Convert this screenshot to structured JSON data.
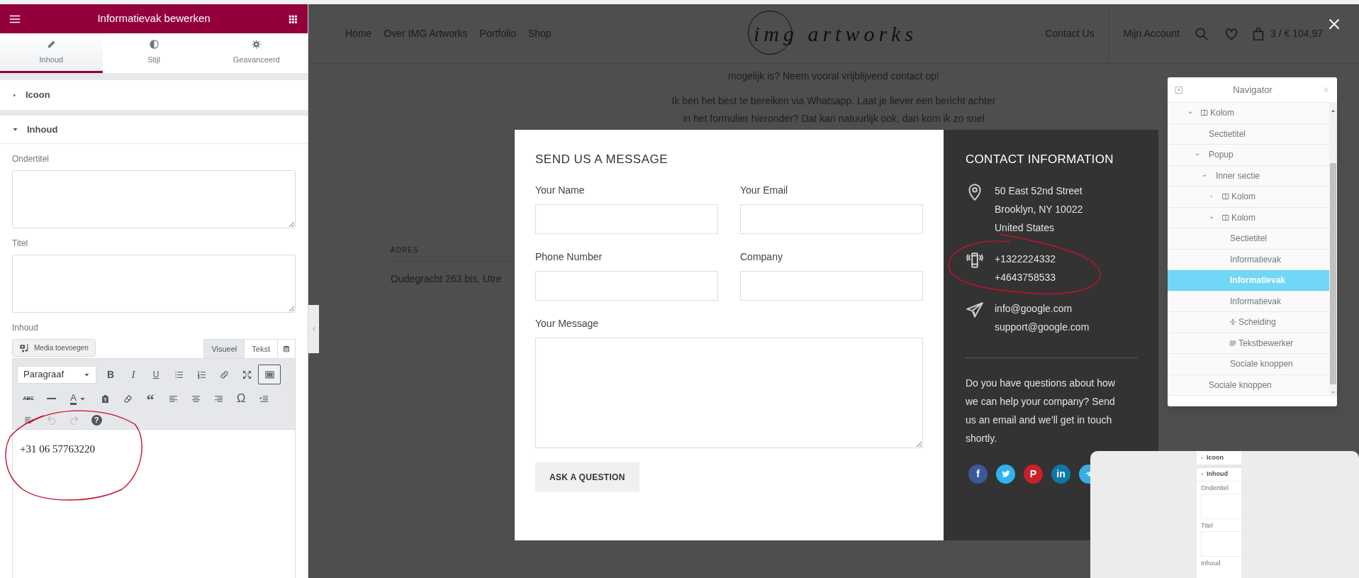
{
  "editor_panel": {
    "title": "Informatievak bewerken",
    "tabs": [
      {
        "label": "Inhoud",
        "kind": "pencil",
        "selected": true
      },
      {
        "label": "Stijl",
        "kind": "contrast",
        "selected": false
      },
      {
        "label": "Geavanceerd",
        "kind": "gear",
        "selected": false
      }
    ],
    "sections": [
      {
        "title": "Icoon",
        "expanded": false
      },
      {
        "title": "Inhoud",
        "expanded": true
      }
    ],
    "fields": [
      {
        "label": "Ondertitel"
      },
      {
        "label": "Titel"
      }
    ],
    "editor": {
      "label": "Inhoud",
      "media_button": "Media toevoegen",
      "modes": [
        {
          "label": "Visueel",
          "selected": true
        },
        {
          "label": "Tekst",
          "selected": false
        }
      ],
      "format": "Paragraaf",
      "toolbar": [
        [
          {
            "kind": "bold",
            "glyph": "B",
            "selected": false
          },
          {
            "kind": "italic",
            "glyph": "I",
            "selected": false
          },
          {
            "kind": "underline",
            "glyph": "U",
            "selected": false
          },
          {
            "kind": "bullet-list",
            "selected": false
          },
          {
            "kind": "numbered-list",
            "selected": false
          },
          {
            "kind": "link",
            "selected": false
          },
          {
            "kind": "fullscreen",
            "selected": false
          },
          {
            "kind": "toolbar-toggle",
            "selected": true
          }
        ],
        [
          {
            "kind": "strikethrough",
            "glyph": "ABC"
          },
          {
            "kind": "horizontal-line"
          },
          {
            "kind": "text-color",
            "glyph": "A"
          },
          {
            "kind": "paste-text"
          },
          {
            "kind": "clear-formatting"
          },
          {
            "kind": "blockquote",
            "glyph": "“"
          },
          {
            "kind": "align-left"
          },
          {
            "kind": "align-center"
          },
          {
            "kind": "align-right"
          },
          {
            "kind": "special-character",
            "glyph": "Ω"
          },
          {
            "kind": "indent"
          }
        ],
        [
          {
            "kind": "outdent",
            "disabled": false
          },
          {
            "kind": "undo",
            "disabled": true
          },
          {
            "kind": "redo",
            "disabled": true
          },
          {
            "kind": "help",
            "glyph": "?",
            "disabled": false
          }
        ]
      ],
      "content": "+31 06 57763220"
    }
  },
  "site_header": {
    "nav": [
      "Home",
      "Over IMG Artworks",
      "Portfolio",
      "Shop"
    ],
    "logo": "img artworks",
    "right_links": [
      "Contact Us",
      "Mijn Account"
    ],
    "cart": "3 / € 104,97"
  },
  "page": {
    "paragraphs": [
      [
        "mogelijk is? Neem vooral vrijblijvend contact op!"
      ],
      [
        "Ik ben het best te bereiken via Whatsapp. Laat je liever een bericht achter",
        "in het formulier hieronder? Dat kan natuurlijk ook, dan kom ik zo snel"
      ]
    ],
    "address_heading": "ADRES",
    "address": "Oudegracht 263 bis, Utre"
  },
  "popup": {
    "form": {
      "title": "SEND US A MESSAGE",
      "fields": [
        {
          "label": "Your Name",
          "kind": "input"
        },
        {
          "label": "Your Email",
          "kind": "input"
        },
        {
          "label": "Phone Number",
          "kind": "input"
        },
        {
          "label": "Company",
          "kind": "input"
        },
        {
          "label": "Your Message",
          "kind": "textarea"
        }
      ],
      "submit": "ASK A QUESTION"
    },
    "contact": {
      "title": "CONTACT INFORMATION",
      "items": [
        {
          "kind": "location",
          "lines": [
            "50 East 52nd Street",
            "Brooklyn, NY 10022",
            "United States"
          ]
        },
        {
          "kind": "phone",
          "lines": [
            "+1322224332",
            "+4643758533"
          ]
        },
        {
          "kind": "send",
          "lines": [
            "info@google.com",
            "support@google.com"
          ]
        }
      ],
      "text": "Do you have questions about how we can help your company? Send us an email and we’ll get in touch shortly.",
      "social": [
        {
          "kind": "facebook",
          "glyph": "f",
          "color": "#3b5998"
        },
        {
          "kind": "twitter",
          "color": "#2ab5f0"
        },
        {
          "kind": "pinterest",
          "glyph": "P",
          "color": "#cb2027"
        },
        {
          "kind": "linkedin",
          "glyph": "in",
          "color": "#0e76a8"
        },
        {
          "kind": "telegram",
          "color": "#37aee2"
        }
      ]
    }
  },
  "navigator": {
    "title": "Navigator",
    "tree": [
      {
        "label": "Kolom",
        "kind": "column",
        "expanded": true,
        "selected": false,
        "children": [
          {
            "label": "Sectietitel",
            "selected": false
          },
          {
            "label": "Popup",
            "expanded": true,
            "selected": false,
            "children": [
              {
                "label": "Inner sectie",
                "expanded": true,
                "selected": false,
                "children": [
                  {
                    "label": "Kolom",
                    "kind": "column",
                    "expanded": false,
                    "selected": false
                  },
                  {
                    "label": "Kolom",
                    "kind": "column",
                    "expanded": true,
                    "selected": false,
                    "children": [
                      {
                        "label": "Sectietitel",
                        "selected": false
                      },
                      {
                        "label": "Informatievak",
                        "selected": false
                      },
                      {
                        "label": "Informatievak",
                        "selected": true
                      },
                      {
                        "label": "Informatievak",
                        "selected": false
                      },
                      {
                        "label": "Scheiding",
                        "kind": "divider",
                        "selected": false
                      },
                      {
                        "label": "Tekstbewerker",
                        "kind": "text",
                        "selected": false
                      },
                      {
                        "label": "Sociale knoppen",
                        "selected": false
                      }
                    ]
                  }
                ]
              }
            ]
          },
          {
            "label": "Sociale knoppen",
            "selected": false
          }
        ]
      }
    ]
  },
  "drag_preview": {
    "sections": [
      {
        "title": "Icoon",
        "expanded": false
      },
      {
        "title": "Inhoud",
        "expanded": true
      }
    ],
    "labels": [
      "Ondertitel",
      "Titel",
      "Inhoud"
    ]
  }
}
